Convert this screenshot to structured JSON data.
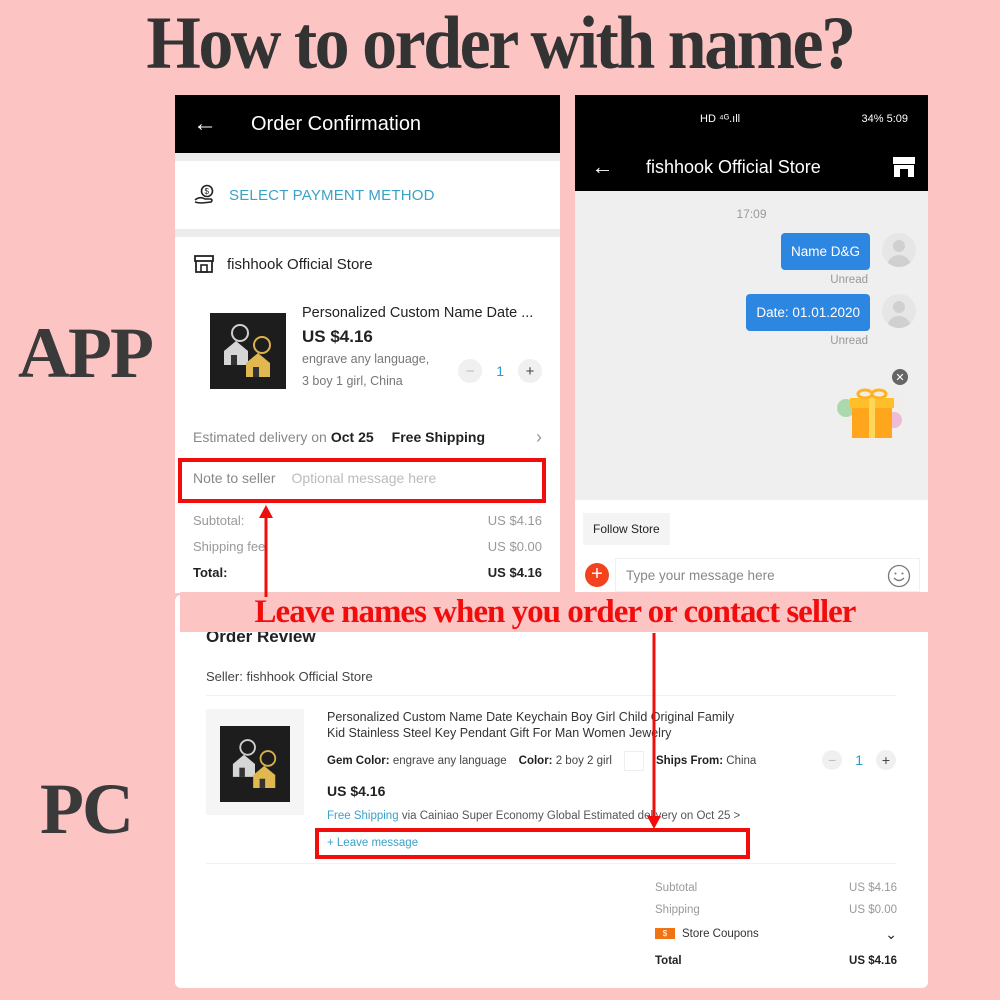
{
  "title": "How to order with name?",
  "labels": {
    "app": "APP",
    "pc": "PC"
  },
  "caption": "Leave names when you order or contact seller",
  "colors": {
    "background": "#fdc4c4",
    "highlight": "#f20d0d",
    "accent_blue": "#3aa1c8",
    "bubble_blue": "#2d86e0"
  },
  "app_order": {
    "header_title": "Order Confirmation",
    "payment_label": "SELECT PAYMENT METHOD",
    "store_name": "fishhook Official Store",
    "product": {
      "name": "Personalized Custom Name Date ...",
      "price": "US $4.16",
      "attr_line1": "engrave any language,",
      "attr_line2": "3 boy 1 girl, China",
      "quantity": "1",
      "minus": "−",
      "plus": "+"
    },
    "delivery_prefix": "Estimated delivery on",
    "delivery_date": "Oct 25",
    "shipping": "Free Shipping",
    "note_label": "Note to seller",
    "note_placeholder": "Optional message here",
    "summary": [
      {
        "label": "Subtotal:",
        "value": "US $4.16"
      },
      {
        "label": "Shipping fee",
        "value": "US $0.00"
      },
      {
        "label": "Total:",
        "value": "US $4.16"
      }
    ]
  },
  "chat": {
    "status_left": "HD ⁴ᴳ.ıll",
    "status_right": "34%  5:09",
    "header_title": "fishhook Official Store",
    "time": "17:09",
    "messages": [
      {
        "text": "Name  D&G",
        "status": "Unread"
      },
      {
        "text": "Date: 01.01.2020",
        "status": "Unread"
      }
    ],
    "follow_label": "Follow Store",
    "input_placeholder": "Type your message here"
  },
  "pc_order": {
    "title": "Order Review",
    "seller": "Seller: fishhook Official Store",
    "product_name": "Personalized Custom Name Date Keychain Boy Girl Child Original Family Kid Stainless Steel Key Pendant Gift For Man Women Jewelry",
    "attrs": [
      {
        "key": "Gem Color:",
        "value": "engrave any language"
      },
      {
        "key": "Color:",
        "value": "2 boy 2 girl"
      },
      {
        "key": "Ships From:",
        "value": "China"
      }
    ],
    "price": "US $4.16",
    "free_shipping": "Free Shipping",
    "shipping_detail": "via Cainiao Super Economy Global  Estimated delivery on Oct 25  >",
    "leave_message": "+ Leave message",
    "quantity": "1",
    "minus": "−",
    "plus": "+",
    "summary": {
      "subtotal_label": "Subtotal",
      "subtotal_value": "US $4.16",
      "shipping_label": "Shipping",
      "shipping_value": "US $0.00",
      "coupons_label": "Store Coupons",
      "coupon_icon": "$",
      "total_label": "Total",
      "total_value": "US $4.16"
    }
  }
}
